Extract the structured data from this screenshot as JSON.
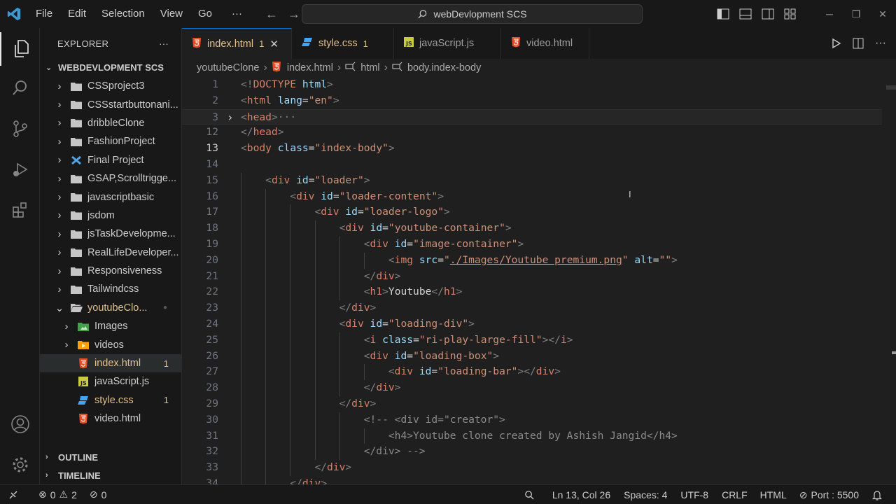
{
  "menu": [
    "File",
    "Edit",
    "Selection",
    "View",
    "Go"
  ],
  "menu_more": "···",
  "search": {
    "label": "webDevlopment SCS"
  },
  "sidebar": {
    "title": "EXPLORER",
    "more": "···",
    "root": "WEBDEVLOPMENT SCS",
    "items": [
      {
        "label": "CSSproject3",
        "kind": "folder",
        "depth": 1,
        "expanded": false
      },
      {
        "label": "CSSstartbuttonani...",
        "kind": "folder",
        "depth": 1,
        "expanded": false
      },
      {
        "label": "dribbleClone",
        "kind": "folder",
        "depth": 1,
        "expanded": false
      },
      {
        "label": "FashionProject",
        "kind": "folder",
        "depth": 1,
        "expanded": false
      },
      {
        "label": "Final Project",
        "kind": "folder-special",
        "depth": 1,
        "expanded": false
      },
      {
        "label": "GSAP,Scrolltrigge...",
        "kind": "folder",
        "depth": 1,
        "expanded": false
      },
      {
        "label": "javascriptbasic",
        "kind": "folder",
        "depth": 1,
        "expanded": false
      },
      {
        "label": "jsdom",
        "kind": "folder",
        "depth": 1,
        "expanded": false
      },
      {
        "label": "jsTaskDevelopme...",
        "kind": "folder",
        "depth": 1,
        "expanded": false
      },
      {
        "label": "RealLifeDeveloper...",
        "kind": "folder",
        "depth": 1,
        "expanded": false
      },
      {
        "label": "Responsiveness",
        "kind": "folder",
        "depth": 1,
        "expanded": false
      },
      {
        "label": "Tailwindcss",
        "kind": "folder",
        "depth": 1,
        "expanded": false
      },
      {
        "label": "youtubeClo...",
        "kind": "folder-open",
        "depth": 1,
        "expanded": true,
        "dot": true
      },
      {
        "label": "Images",
        "kind": "folder-images",
        "depth": 2,
        "expanded": false
      },
      {
        "label": "videos",
        "kind": "folder-videos",
        "depth": 2,
        "expanded": false
      },
      {
        "label": "index.html",
        "kind": "html",
        "depth": 2,
        "badge": "1",
        "selected": true
      },
      {
        "label": "javaScript.js",
        "kind": "js",
        "depth": 2
      },
      {
        "label": "style.css",
        "kind": "css",
        "depth": 2,
        "badge": "1"
      },
      {
        "label": "video.html",
        "kind": "html",
        "depth": 2
      }
    ],
    "outline": "OUTLINE",
    "timeline": "TIMELINE"
  },
  "tabs": [
    {
      "label": "index.html",
      "kind": "html",
      "badge": "1",
      "active": true,
      "close": "✕"
    },
    {
      "label": "style.css",
      "kind": "css",
      "badge": "1"
    },
    {
      "label": "javaScript.js",
      "kind": "js"
    },
    {
      "label": "video.html",
      "kind": "html"
    }
  ],
  "breadcrumbs": [
    "youtubeClone",
    "index.html",
    "html",
    "body.index-body"
  ],
  "code_lines": [
    {
      "n": "1",
      "html": "<span class=\"t\">&lt;!</span><span class=\"tagr\">DOCTYPE</span> <span class=\"attr\">html</span><span class=\"t\">&gt;</span>"
    },
    {
      "n": "2",
      "html": "<span class=\"t\">&lt;</span><span class=\"tagr\">html</span> <span class=\"attr\">lang</span><span class=\"txt\">=</span><span class=\"str\">\"en\"</span><span class=\"t\">&gt;</span>"
    },
    {
      "n": "3",
      "html": "<span class=\"t\">&lt;</span><span class=\"tagr\">head</span><span class=\"t\">&gt;</span><span class=\"t\">···</span>",
      "fold": true,
      "highlight": true
    },
    {
      "n": "12",
      "html": "<span class=\"t\">&lt;/</span><span class=\"tagr\">head</span><span class=\"t\">&gt;</span>"
    },
    {
      "n": "13",
      "html": "<span class=\"t\">&lt;</span><span class=\"tagr\">body</span> <span class=\"attr\">class</span><span class=\"txt\">=</span><span class=\"str\">\"index-body\"</span><span class=\"t\">&gt;</span>",
      "current": true
    },
    {
      "n": "14",
      "html": ""
    },
    {
      "n": "15",
      "html": "    <span class=\"t\">&lt;</span><span class=\"tagr\">div</span> <span class=\"attr\">id</span><span class=\"txt\">=</span><span class=\"str\">\"loader\"</span><span class=\"t\">&gt;</span>"
    },
    {
      "n": "16",
      "html": "        <span class=\"t\">&lt;</span><span class=\"tagr\">div</span> <span class=\"attr\">id</span><span class=\"txt\">=</span><span class=\"str\">\"loader-content\"</span><span class=\"t\">&gt;</span>"
    },
    {
      "n": "17",
      "html": "            <span class=\"t\">&lt;</span><span class=\"tagr\">div</span> <span class=\"attr\">id</span><span class=\"txt\">=</span><span class=\"str\">\"loader-logo\"</span><span class=\"t\">&gt;</span>"
    },
    {
      "n": "18",
      "html": "                <span class=\"t\">&lt;</span><span class=\"tagr\">div</span> <span class=\"attr\">id</span><span class=\"txt\">=</span><span class=\"str\">\"youtube-container\"</span><span class=\"t\">&gt;</span>"
    },
    {
      "n": "19",
      "html": "                    <span class=\"t\">&lt;</span><span class=\"tagr\">div</span> <span class=\"attr\">id</span><span class=\"txt\">=</span><span class=\"str\">\"image-container\"</span><span class=\"t\">&gt;</span>"
    },
    {
      "n": "20",
      "html": "                        <span class=\"t\">&lt;</span><span class=\"tagr\">img</span> <span class=\"attr\">src</span><span class=\"txt\">=</span><span class=\"str\">\"</span><span class=\"link\">./Images/Youtube premium.png</span><span class=\"str\">\"</span> <span class=\"attr\">alt</span><span class=\"txt\">=</span><span class=\"str\">\"\"</span><span class=\"t\">&gt;</span>"
    },
    {
      "n": "21",
      "html": "                    <span class=\"t\">&lt;/</span><span class=\"tagr\">div</span><span class=\"t\">&gt;</span>"
    },
    {
      "n": "22",
      "html": "                    <span class=\"t\">&lt;</span><span class=\"tagr\">h1</span><span class=\"t\">&gt;</span><span class=\"txt\">Youtube</span><span class=\"t\">&lt;/</span><span class=\"tagr\">h1</span><span class=\"t\">&gt;</span>"
    },
    {
      "n": "23",
      "html": "                <span class=\"t\">&lt;/</span><span class=\"tagr\">div</span><span class=\"t\">&gt;</span>"
    },
    {
      "n": "24",
      "html": "                <span class=\"t\">&lt;</span><span class=\"tagr\">div</span> <span class=\"attr\">id</span><span class=\"txt\">=</span><span class=\"str\">\"loading-div\"</span><span class=\"t\">&gt;</span>"
    },
    {
      "n": "25",
      "html": "                    <span class=\"t\">&lt;</span><span class=\"tagr\">i</span> <span class=\"attr\">class</span><span class=\"txt\">=</span><span class=\"str\">\"ri-play-large-fill\"</span><span class=\"t\">&gt;&lt;/</span><span class=\"tagr\">i</span><span class=\"t\">&gt;</span>"
    },
    {
      "n": "26",
      "html": "                    <span class=\"t\">&lt;</span><span class=\"tagr\">div</span> <span class=\"attr\">id</span><span class=\"txt\">=</span><span class=\"str\">\"loading-box\"</span><span class=\"t\">&gt;</span>"
    },
    {
      "n": "27",
      "html": "                        <span class=\"t\">&lt;</span><span class=\"tagr\">div</span> <span class=\"attr\">id</span><span class=\"txt\">=</span><span class=\"str\">\"loading-bar\"</span><span class=\"t\">&gt;&lt;/</span><span class=\"tagr\">div</span><span class=\"t\">&gt;</span>"
    },
    {
      "n": "28",
      "html": "                    <span class=\"t\">&lt;/</span><span class=\"tagr\">div</span><span class=\"t\">&gt;</span>"
    },
    {
      "n": "29",
      "html": "                <span class=\"t\">&lt;/</span><span class=\"tagr\">div</span><span class=\"t\">&gt;</span>"
    },
    {
      "n": "30",
      "html": "                    <span class=\"cmt\">&lt;!-- &lt;div id=\"creator\"&gt;</span>"
    },
    {
      "n": "31",
      "html": "                        <span class=\"cmt\">&lt;h4&gt;Youtube clone created by Ashish Jangid&lt;/h4&gt;</span>"
    },
    {
      "n": "32",
      "html": "                    <span class=\"cmt\">&lt;/div&gt; --&gt;</span>"
    },
    {
      "n": "33",
      "html": "            <span class=\"t\">&lt;/</span><span class=\"tagr\">div</span><span class=\"t\">&gt;</span>"
    },
    {
      "n": "34",
      "html": "        <span class=\"t\">&lt;/</span><span class=\"tagr\">div</span><span class=\"t\">&gt;</span>"
    }
  ],
  "status": {
    "errors": "0",
    "warnings": "2",
    "ports": "0",
    "position": "Ln 13, Col 26",
    "spaces": "Spaces: 4",
    "encoding": "UTF-8",
    "eol": "CRLF",
    "language": "HTML",
    "port": "Port : 5500"
  },
  "colors": {
    "accent": "#0078d4",
    "html_icon": "#e44d26",
    "css_icon": "#42a5f5",
    "js_icon": "#cbcb41",
    "modified": "#e2c08d"
  },
  "icons": [
    "vscode-logo-icon",
    "files-icon",
    "search-icon",
    "source-control-icon",
    "run-debug-icon",
    "extensions-icon",
    "account-icon",
    "settings-gear-icon"
  ]
}
